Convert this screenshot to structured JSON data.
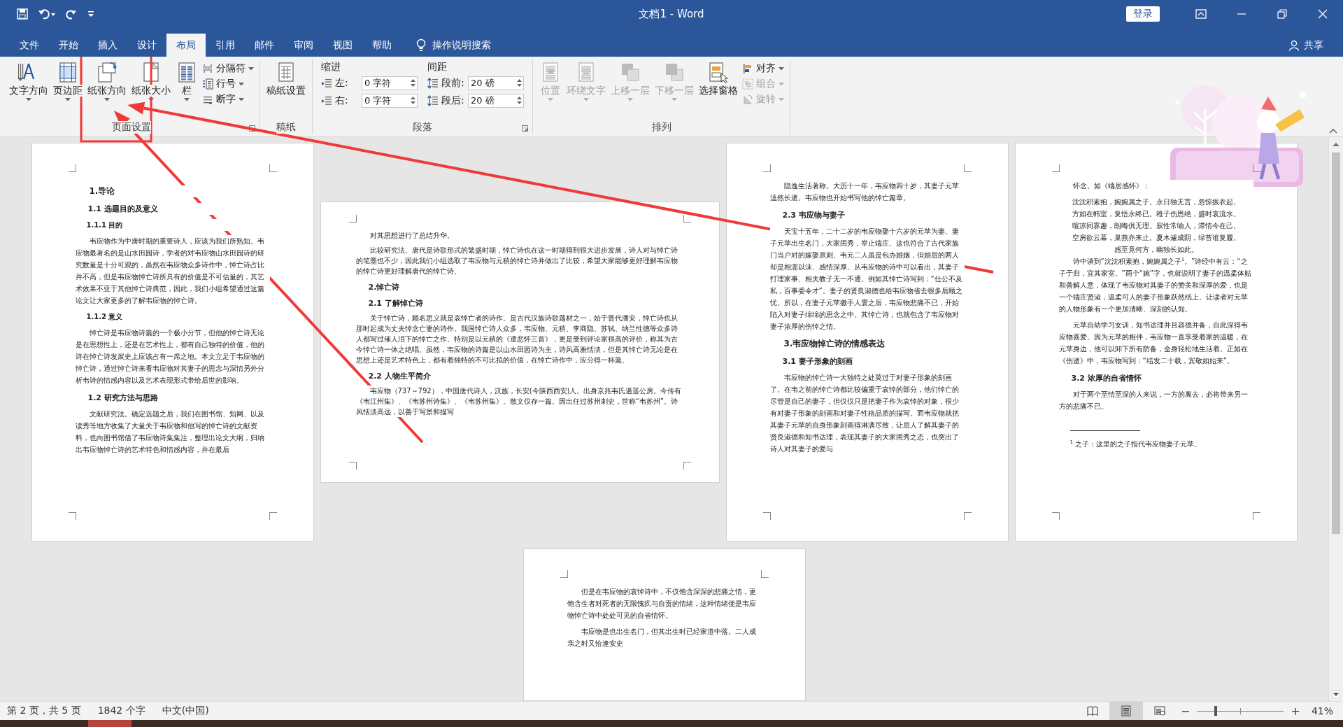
{
  "title_bar": {
    "title": "文档1 - Word",
    "sign_in": "登录"
  },
  "tabs": [
    {
      "label": "文件",
      "selected": false
    },
    {
      "label": "开始",
      "selected": false
    },
    {
      "label": "插入",
      "selected": false
    },
    {
      "label": "设计",
      "selected": false
    },
    {
      "label": "布局",
      "selected": true
    },
    {
      "label": "引用",
      "selected": false
    },
    {
      "label": "邮件",
      "selected": false
    },
    {
      "label": "审阅",
      "selected": false
    },
    {
      "label": "视图",
      "selected": false
    },
    {
      "label": "帮助",
      "selected": false
    }
  ],
  "tell_me": "操作说明搜索",
  "share": "共享",
  "ribbon": {
    "groups": [
      {
        "kind": "buttons",
        "label": "页面设置",
        "launcher": true,
        "large_buttons": [
          {
            "label": "文字方向",
            "dropdown": true,
            "disabled": false
          },
          {
            "label": "页边距",
            "dropdown": true,
            "disabled": false
          },
          {
            "label": "纸张方向",
            "dropdown": true,
            "disabled": false
          },
          {
            "label": "纸张大小",
            "dropdown": true,
            "disabled": false
          },
          {
            "label": "栏",
            "dropdown": true,
            "disabled": false
          }
        ],
        "small_buttons": [
          {
            "label": "分隔符",
            "dropdown": true,
            "disabled": false
          },
          {
            "label": "行号",
            "dropdown": true,
            "disabled": false
          },
          {
            "label": "断字",
            "dropdown": true,
            "disabled": false
          }
        ]
      },
      {
        "kind": "buttons",
        "label": "稿纸",
        "large_buttons": [
          {
            "label": "稿纸设置",
            "dropdown": false,
            "disabled": false
          }
        ]
      },
      {
        "kind": "paragraph",
        "label": "段落",
        "launcher": true,
        "indent": {
          "heading": "缩进",
          "fields": [
            {
              "label": "左:",
              "value": "0 字符"
            },
            {
              "label": "右:",
              "value": "0 字符"
            }
          ]
        },
        "spacing": {
          "heading": "间距",
          "fields": [
            {
              "label": "段前:",
              "value": "20 磅"
            },
            {
              "label": "段后:",
              "value": "20 磅"
            }
          ]
        }
      },
      {
        "kind": "buttons",
        "label": "排列",
        "large_buttons": [
          {
            "label": "位置",
            "dropdown": true,
            "disabled": true
          },
          {
            "label": "环绕文字",
            "dropdown": true,
            "disabled": true
          },
          {
            "label": "上移一层",
            "dropdown": true,
            "disabled": true
          },
          {
            "label": "下移一层",
            "dropdown": true,
            "disabled": true
          },
          {
            "label": "选择窗格",
            "dropdown": false,
            "disabled": false
          }
        ],
        "small_buttons": [
          {
            "label": "对齐",
            "dropdown": true,
            "disabled": false
          },
          {
            "label": "组合",
            "dropdown": true,
            "disabled": true
          },
          {
            "label": "旋转",
            "dropdown": true,
            "disabled": true
          }
        ]
      }
    ]
  },
  "document": {
    "rows": [
      {
        "pages": [
          {
            "kind": "portrait",
            "blocks": [
              {
                "kind": "h1",
                "text": "1.导论"
              },
              {
                "kind": "h2",
                "text": "1.1 选题目的及意义"
              },
              {
                "kind": "h3",
                "text": "1.1.1 目的"
              },
              {
                "kind": "p",
                "text": "韦应物作为中唐时期的重要诗人，应该为我们所熟知。韦应物最著名的是山水田园诗，学者的对韦应物山水田园诗的研究数量是十分可观的，虽然在韦应物众多诗作中，悼亡诗占比并不高，但是韦应物悼亡诗所具有的价值是不可估量的，其艺术效果不亚于其他悼亡诗典范，因此，我们小组希望通过这篇论文让大家更多的了解韦应物的悼亡诗。"
              },
              {
                "kind": "h3",
                "text": "1.1.2 意义"
              },
              {
                "kind": "p",
                "text": "悼亡诗是韦应物诗篇的一个极小分节，但他的悼亡诗无论是在思想性上，还是在艺术性上，都有自己独特的价值，他的诗在悼亡诗发展史上应该占有一席之地。本文立足于韦应物的悼亡诗，通过悼亡诗来看韦应物对其妻子的思念与深情另外分析韦诗的情感内容以及艺术表现形式带给后世的影响。"
              },
              {
                "kind": "h2",
                "text": "1.2 研究方法与思路"
              },
              {
                "kind": "p",
                "text": "文献研究法。确定选题之后，我们在图书馆、知网、以及读秀等地方收集了大量关于韦应物和他写的悼亡诗的文献资料，也向图书馆借了韦应物诗集集注，整理出论文大纲，归纳出韦应物悼亡诗的艺术特色和情感内容，并在最后"
              }
            ]
          },
          {
            "kind": "landscape",
            "blocks": [
              {
                "kind": "p",
                "text": "对其思想进行了总结升华。"
              },
              {
                "kind": "p",
                "text": "比较研究法。唐代是诗歌形式的繁盛时期，悼亡诗也在这一时期得到很大进步发展，诗人对与悼亡诗的笔墨也不少，因此我们小组选取了韦应物与元稹的悼亡诗并做出了比较，希望大家能够更好理解韦应物的悼亡诗更好理解唐代的悼亡诗。"
              },
              {
                "kind": "h2",
                "text": "2.悼亡诗"
              },
              {
                "kind": "h2",
                "text": "2.1 了解悼亡诗"
              },
              {
                "kind": "p",
                "text": "关于悼亡诗，顾名思义就是哀悼亡者的诗作。是古代汉族诗歌题材之一，始于晋代潘安，悼亡诗也从那时起成为丈夫悼念亡妻的诗作。我国悼亡诗人众多，韦应物、元稹、李商隐、苏轼、纳兰性德等众多诗人都写过催人泪下的悼亡之作。特别是以元稹的《遣悲怀三首》，更是受到评论家很高的评价，称其为古今悼亡诗一体之绝唱。虽然，韦应物的诗篇是以山水田园诗为主，诗风高雅恬淡，但是其悼亡诗无论是在思想上还是艺术特色上，都有着独特的不可比拟的价值，在悼亡诗作中，应分得一杯羹。"
              },
              {
                "kind": "h2",
                "text": "2.2 人物生平简介"
              },
              {
                "kind": "p",
                "text": "韦应物（737～792），中国唐代诗人，汉族，长安(今陕西西安)人。出身京兆韦氏逍遥公房。今传有《韦江州集》、《韦苏州诗集》、《韦苏州集》。散文仅存一篇。因出任过苏州刺史，世称“韦苏州”。诗风恬淡高远，以善于写景和描写"
              }
            ]
          },
          {
            "kind": "portrait",
            "blocks": [
              {
                "kind": "p",
                "text": "隐逸生活著称。大历十一年，韦应物四十岁，其妻子元苹溘然长逝。韦应物也开始书写他的悼亡篇章。"
              },
              {
                "kind": "h2",
                "text": "2.3 韦应物与妻子"
              },
              {
                "kind": "p",
                "text": "天宝十五年，二十二岁的韦应物娶十六岁的元苹为妻。妻子元苹出生名门，大家闺秀，举止端庄。这也符合了古代家族门当户对的嫁娶原则。韦元二人虽是包办婚姻，但婚后的两人却是相濡以沫、感情深厚。从韦应物的诗中可以看出，其妻子打理家事、相夫教子无一不通。例如其悼亡诗写到：“仕公不及私，百事委令才”。妻子的贤良淑德也给韦应物省去很多后顾之忧。所以，在妻子元苹撒手人寰之后，韦应物悲痛不已，开始陷入对妻子绵绵的思念之中。其悼亡诗，也就包含了韦应物对妻子浓厚的伤悼之情。"
              },
              {
                "kind": "h1",
                "text": "3.韦应物悼亡诗的情感表达"
              },
              {
                "kind": "h2",
                "text": "3.1 妻子形象的刻画"
              },
              {
                "kind": "p",
                "text": "韦应物的悼亡诗一大独特之处莫过于对妻子形象的刻画了。在韦之前的悼亡诗都比较偏重于哀悼的部分，他们悼亡的尽管是自己的妻子，但仅仅只是把妻子作为哀悼的对象，很少有对妻子形象的刻画和对妻子性格品质的描写。而韦应物就把其妻子元苹的自身形象刻画得淋漓尽致，让后人了解其妻子的贤良淑德和知书达理，表现其妻子的大家闺秀之态，也突出了诗人对其妻子的爱与"
              }
            ]
          },
          {
            "kind": "portrait",
            "blocks": [
              {
                "kind": "p",
                "text": "怀念。如《端居感怀》："
              },
              {
                "kind": "poem",
                "text": "沈沈积素抱，婉婉属之子。永日独无言，忽惊振衣起。"
              },
              {
                "kind": "poem",
                "text": "方如在帏室，复悟永终已。稚子伤恩绝，盛时哀流水。"
              },
              {
                "kind": "poem",
                "text": "暄凉同寡趣，朗晦俱无理。寂性常喻人，滞情今在己。"
              },
              {
                "kind": "poem",
                "text": "空房欲云暮，巢燕亦来止。夏木遽成阴，绿苔谁复履。"
              },
              {
                "kind": "poem",
                "text": "感至竟何方，幽独长如此。"
              },
              {
                "kind": "p",
                "text": "诗中谈到“沈沈积素抱，婉婉属之子$^{1}$。”诗经中有云：“之子于归，宜其家室。”两个“婉”字，也就说明了妻子的温柔体贴和善解人意，体现了韦应物对其妻子的赞美和深厚的爱，也是一个端庄贤淑，温柔可人的妻子形象跃然纸上。让读者对元苹的人物形象有一个更加清晰、深刻的认知。"
              },
              {
                "kind": "p",
                "text": "元苹自幼学习女训，知书达理并且容德并备，自此深得韦应物喜爱。因为元苹的相伴，韦应物一直享受着家的温暖，在元苹身边，他可以卸下所有防备，全身轻松地生活着。正如在《伤逝》中，韦应物写到：“结发二十载，宾敬如始来”。"
              },
              {
                "kind": "h2",
                "text": "3.2 浓厚的自省情怀"
              },
              {
                "kind": "p",
                "text": "对于两个至情至深的人来说，一方的离去，必将带来另一方的悲痛不已。"
              },
              {
                "kind": "footnote",
                "text": "$^{1}$ 之子：这里的之子指代韦应物妻子元苹。"
              }
            ]
          }
        ]
      },
      {
        "pages": [
          {
            "kind": "portrait",
            "blocks": [
              {
                "kind": "p",
                "text": "但是在韦应物的哀悼诗中，不仅饱含深深的悲痛之情，更饱含生者对死者的无限愧疚与自责的情绪，这种情绪便是韦应物悼亡诗中处处可见的自省情怀。"
              },
              {
                "kind": "p",
                "text": "韦应物是也出生名门，但其出生时已经家道中落。二人成亲之时又恰逢安史"
              }
            ]
          }
        ]
      }
    ]
  },
  "status_bar": {
    "page": "第 2 页，共 5 页",
    "words": "1842 个字",
    "language": "中文(中国)",
    "views": [
      {
        "selected": false
      },
      {
        "selected": true
      },
      {
        "selected": false
      }
    ],
    "zoom_out": "−",
    "zoom_in": "+",
    "zoom": {
      "level": 0.2,
      "percent": "41%"
    }
  },
  "annotations": [
    {
      "kind": "frame"
    },
    {
      "kind": "arrow"
    },
    {
      "kind": "arrow"
    }
  ]
}
